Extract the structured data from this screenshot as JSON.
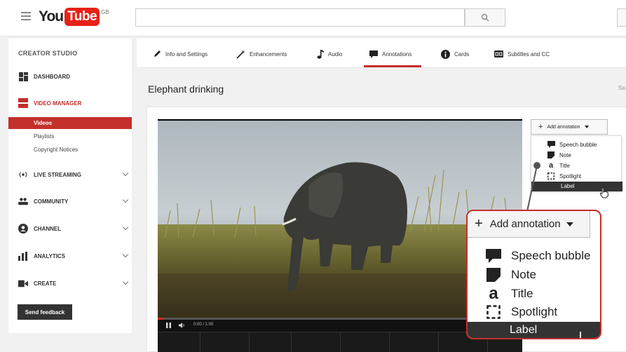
{
  "header": {
    "logo_you": "You",
    "logo_tube": "Tube",
    "logo_region": "GB",
    "search_placeholder": ""
  },
  "sidebar": {
    "title": "CREATOR STUDIO",
    "items": [
      {
        "label": "DASHBOARD",
        "icon": "dashboard-icon"
      },
      {
        "label": "VIDEO MANAGER",
        "icon": "video-manager-icon",
        "active": true
      },
      {
        "label": "LIVE STREAMING",
        "icon": "live-streaming-icon"
      },
      {
        "label": "COMMUNITY",
        "icon": "community-icon"
      },
      {
        "label": "CHANNEL",
        "icon": "channel-icon"
      },
      {
        "label": "ANALYTICS",
        "icon": "analytics-icon"
      },
      {
        "label": "CREATE",
        "icon": "create-icon"
      }
    ],
    "sub_items": [
      "Videos",
      "Playlists",
      "Copyright Notices"
    ],
    "feedback_label": "Send feedback"
  },
  "tabs": [
    {
      "label": "Info and Settings",
      "icon": "pencil-icon"
    },
    {
      "label": "Enhancements",
      "icon": "magic-wand-icon"
    },
    {
      "label": "Audio",
      "icon": "music-note-icon"
    },
    {
      "label": "Annotations",
      "icon": "speech-bubble-icon",
      "active": true
    },
    {
      "label": "Cards",
      "icon": "info-icon"
    },
    {
      "label": "Subtitles and CC",
      "icon": "cc-icon"
    }
  ],
  "video": {
    "title": "Elephant drinking",
    "save_fragment": "Sa",
    "time_display": "0:00 / 1:00"
  },
  "annotation_menu": {
    "button_label": "Add annotation",
    "items": [
      "Speech bubble",
      "Note",
      "Title",
      "Spotlight",
      "Label"
    ],
    "selected": "Label"
  },
  "colors": {
    "accent": "#c4302b",
    "youtube_red": "#e62117"
  }
}
